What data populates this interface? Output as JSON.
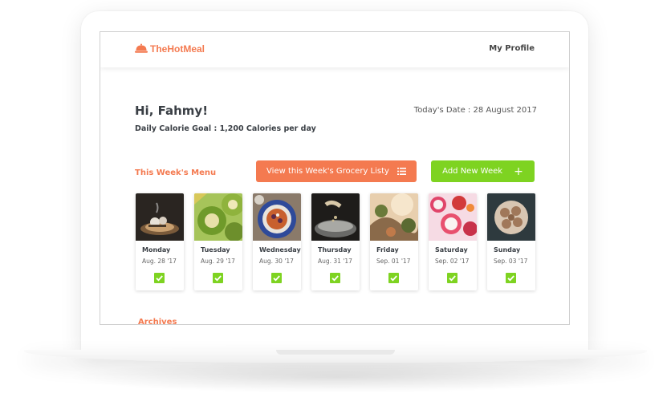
{
  "app": {
    "brand": "TheHotMeal",
    "profile_link": "My Profile"
  },
  "header": {
    "greeting": "Hi, Fahmy!",
    "calorie_goal": "Daily Calorie Goal : 1,200 Calories per day",
    "today_date": "Today's Date : 28 August 2017"
  },
  "menu": {
    "section_title": "This Week's Menu",
    "grocery_button": "View this Week's Grocery Listy",
    "add_week_button": "Add New Week",
    "days": [
      {
        "name": "Monday",
        "date": "Aug. 28 '17",
        "checked": true
      },
      {
        "name": "Tuesday",
        "date": "Aug. 29 '17",
        "checked": true
      },
      {
        "name": "Wednesday",
        "date": "Aug. 30 '17",
        "checked": true
      },
      {
        "name": "Thursday",
        "date": "Aug. 31 '17",
        "checked": true
      },
      {
        "name": "Friday",
        "date": "Sep. 01 '17",
        "checked": true
      },
      {
        "name": "Saturday",
        "date": "Sep. 02 '17",
        "checked": true
      },
      {
        "name": "Sunday",
        "date": "Sep. 03 '17",
        "checked": true
      }
    ]
  },
  "archives": {
    "title": "Archives"
  },
  "colors": {
    "accent_orange": "#f47a50",
    "accent_green": "#7ed321",
    "text_dark": "#3a3f45"
  },
  "icons": {
    "brand": "cloche-icon",
    "grocery": "list-icon",
    "add": "plus-icon",
    "check": "checkmark-icon"
  }
}
